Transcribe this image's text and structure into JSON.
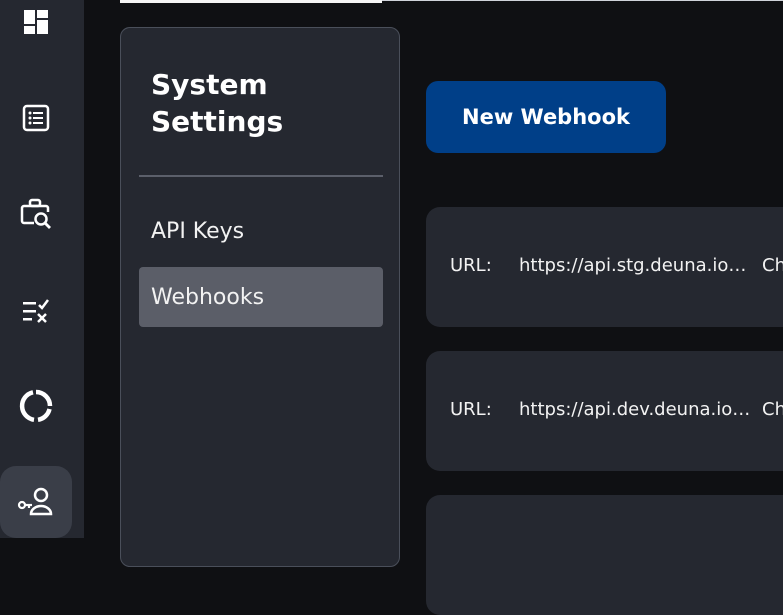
{
  "nav_rail": {
    "icons": [
      "dashboard-icon",
      "list-icon",
      "briefcase-search-icon",
      "checklist-icon",
      "donut-chart-icon",
      "key-user-icon"
    ],
    "active": "key-user-icon"
  },
  "settings": {
    "title": "System Settings",
    "menu": [
      {
        "label": "API Keys",
        "selected": false
      },
      {
        "label": "Webhooks",
        "selected": true
      }
    ]
  },
  "actions": {
    "new_webhook_label": "New Webhook"
  },
  "webhooks": [
    {
      "url_label": "URL:",
      "url": "https://api.stg.deuna.io/merchants/webhooks",
      "extra": "Ch"
    },
    {
      "url_label": "URL:",
      "url": "https://api.dev.deuna.io/merchants/webhooks",
      "extra": "Ch"
    }
  ],
  "colors": {
    "background": "#0f1013",
    "panel": "#252830",
    "accent_button": "#003f88",
    "selected_item": "#5b5e68"
  }
}
